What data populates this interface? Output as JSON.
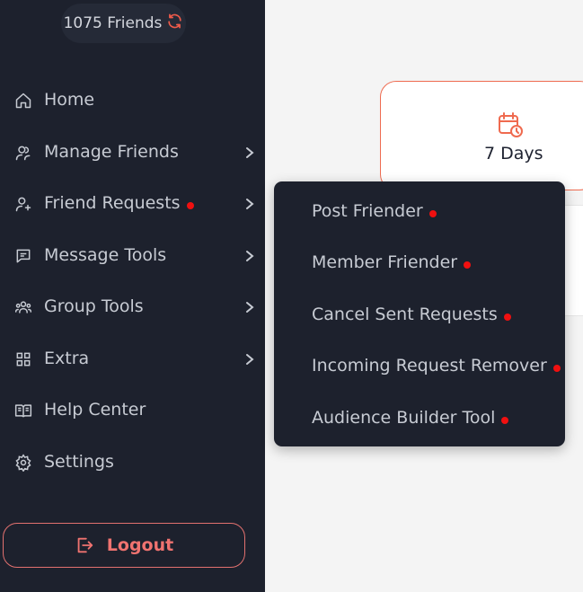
{
  "sidebar": {
    "friends_count": "1075 Friends",
    "items": [
      {
        "label": "Home",
        "icon": "home-icon"
      },
      {
        "label": "Manage Friends",
        "icon": "users-icon",
        "has_submenu": true
      },
      {
        "label": "Friend Requests",
        "icon": "user-plus-icon",
        "has_submenu": true,
        "has_notification": true
      },
      {
        "label": "Message Tools",
        "icon": "message-icon",
        "has_submenu": true
      },
      {
        "label": "Group Tools",
        "icon": "group-icon",
        "has_submenu": true
      },
      {
        "label": "Extra",
        "icon": "grid-icon",
        "has_submenu": true
      },
      {
        "label": "Help Center",
        "icon": "book-icon"
      },
      {
        "label": "Settings",
        "icon": "gear-icon"
      }
    ],
    "logout_label": "Logout"
  },
  "main": {
    "card": {
      "label": "7 Days",
      "icon": "calendar-clock-icon"
    }
  },
  "dropdown": {
    "items": [
      {
        "label": "Post Friender"
      },
      {
        "label": "Member Friender"
      },
      {
        "label": "Cancel Sent Requests"
      },
      {
        "label": "Incoming Request Remover"
      },
      {
        "label": "Audience Builder Tool"
      }
    ]
  },
  "colors": {
    "sidebar_bg": "#1d212d",
    "accent": "#ef6a4f",
    "notification_dot": "#f01010",
    "text": "#c7cbd3",
    "main_bg": "#f4f4f4"
  }
}
